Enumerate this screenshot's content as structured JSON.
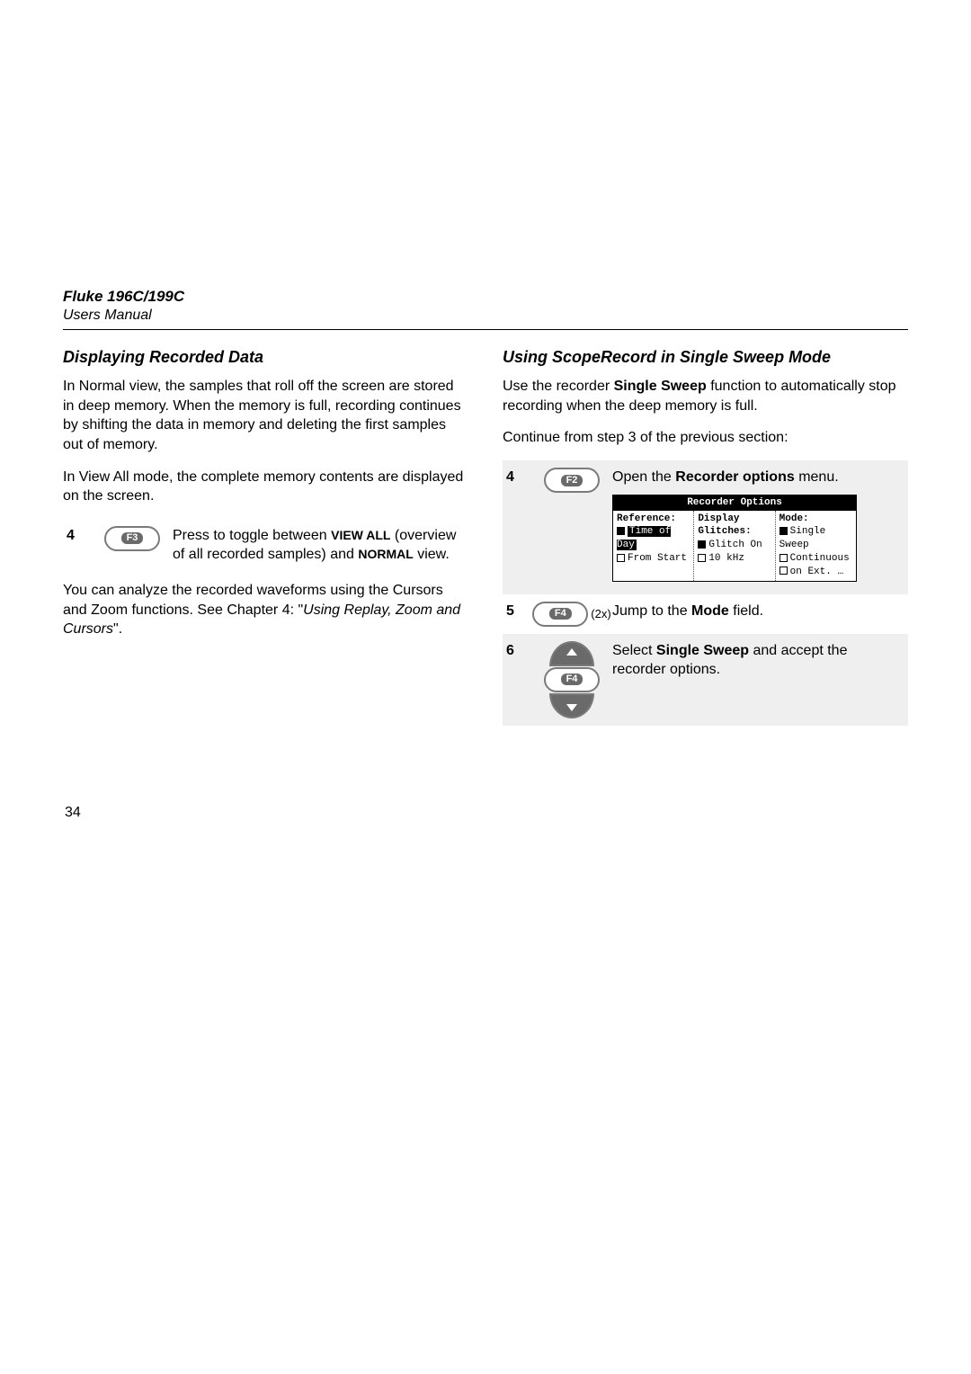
{
  "header": {
    "model": "Fluke 196C/199C",
    "manual_type": "Users Manual"
  },
  "left": {
    "title": "Displaying Recorded Data",
    "p1": "In Normal view, the samples that roll off the screen are stored in deep memory. When the memory is full, recording continues by shifting the data in memory and deleting the first samples out of memory.",
    "p2": "In View All mode, the complete memory contents are displayed on the screen.",
    "step4": {
      "num": "4",
      "key_label": "F3",
      "text_pre": "Press to toggle between ",
      "view_all": "VIEW ALL",
      "text_mid": " (overview of all recorded samples) and ",
      "normal": "NORMAL",
      "text_post": " view."
    },
    "p3_pre": "You can analyze the recorded waveforms using the Cursors and Zoom functions. See Chapter 4: \"",
    "p3_em": "Using Replay, Zoom and Cursors",
    "p3_post": "\"."
  },
  "right": {
    "title": "Using ScopeRecord in Single Sweep Mode",
    "p1_pre": "Use the recorder ",
    "p1_bold": "Single Sweep",
    "p1_post": " function to automatically stop recording when the deep memory is full.",
    "p2": "Continue from step 3 of the previous section:",
    "step4": {
      "num": "4",
      "key_label": "F2",
      "text_pre": "Open the ",
      "text_bold": "Recorder options",
      "text_post": " menu."
    },
    "menu": {
      "title": "Recorder Options",
      "col1_label": "Reference:",
      "col1_opt1": "Time of Day",
      "col1_opt2": "From Start",
      "col2_label1": "Display",
      "col2_label2": "Glitches:",
      "col2_opt1": "Glitch On",
      "col2_opt2": "10 kHz",
      "col3_label": "Mode:",
      "col3_opt1": "Single Sweep",
      "col3_opt2": "Continuous",
      "col3_opt3": "on Ext. …"
    },
    "step5": {
      "num": "5",
      "key_label": "F4",
      "times": "(2x)",
      "text_pre": "Jump to the ",
      "text_bold": "Mode",
      "text_post": " field."
    },
    "step6": {
      "num": "6",
      "key_label": "F4",
      "text_pre": "Select ",
      "text_bold": "Single Sweep",
      "text_post": " and accept the recorder options."
    }
  },
  "page_number": "34"
}
